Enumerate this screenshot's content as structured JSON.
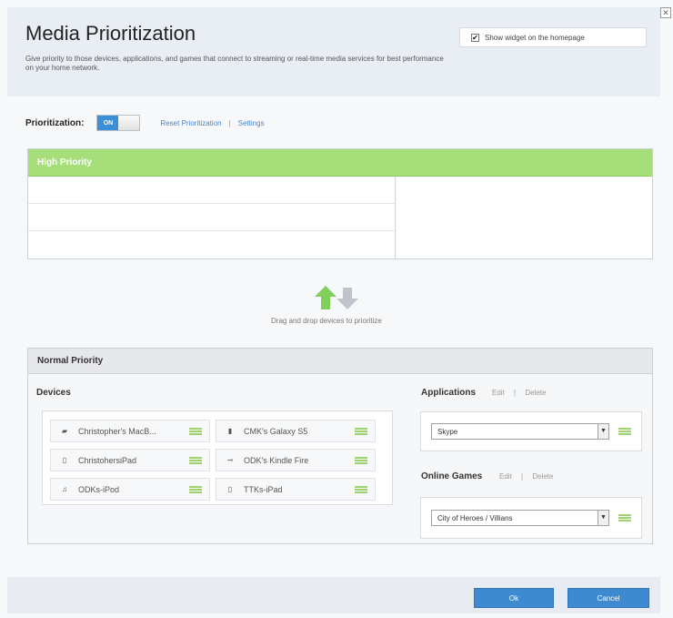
{
  "header": {
    "title": "Media Prioritization",
    "description": "Give priority to those devices, applications, and games that connect to streaming or real-time media services for best performance on your home network.",
    "widget_label": "Show widget on the homepage",
    "widget_checked": true
  },
  "prioritization": {
    "label": "Prioritization:",
    "toggle_state": "ON",
    "reset_link": "Reset Prioritization",
    "separator": "|",
    "settings_link": "Settings"
  },
  "high_priority": {
    "title": "High Priority",
    "header_color": "#a6df7a"
  },
  "drag_hint": "Drag and drop devices to prioritize",
  "normal_priority": {
    "title": "Normal Priority",
    "devices_label": "Devices",
    "devices": [
      {
        "name": "Christopher's MacB...",
        "icon": "laptop-icon"
      },
      {
        "name": "CMK's Galaxy S5",
        "icon": "phone-icon"
      },
      {
        "name": "ChristohersiPad",
        "icon": "tablet-icon"
      },
      {
        "name": "ODK's Kindle Fire",
        "icon": "device-icon"
      },
      {
        "name": "ODKs-iPod",
        "icon": "music-player-icon"
      },
      {
        "name": "TTKs-iPad",
        "icon": "tablet-icon"
      }
    ],
    "applications": {
      "label": "Applications",
      "edit": "Edit",
      "separator": "|",
      "delete": "Delete",
      "selected": "Skype"
    },
    "online_games": {
      "label": "Online Games",
      "edit": "Edit",
      "separator": "|",
      "delete": "Delete",
      "selected": "City of Heroes / Villians"
    }
  },
  "footer": {
    "ok_label": "Ok",
    "cancel_label": "Cancel"
  },
  "colors": {
    "accent_blue": "#3d8ad1",
    "priority_green": "#a6df7a",
    "grip_green": "#9fd36e"
  }
}
